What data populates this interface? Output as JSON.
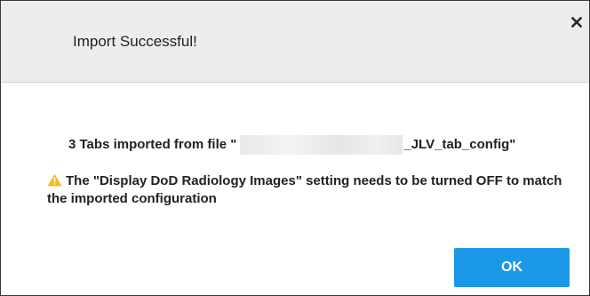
{
  "dialog": {
    "title": "Import Successful!",
    "close_icon": "close-icon",
    "message": {
      "prefix": "3 Tabs imported from file \"",
      "filename_suffix": "_JLV_tab_config\""
    },
    "warning": {
      "icon": "warning-triangle-icon",
      "icon_color": "#f5b921",
      "text": "The \"Display DoD Radiology Images\" setting needs to be turned OFF to match the imported configuration"
    },
    "ok_label": "OK",
    "colors": {
      "accent": "#1b99e8",
      "header_bg": "#ededed"
    }
  }
}
